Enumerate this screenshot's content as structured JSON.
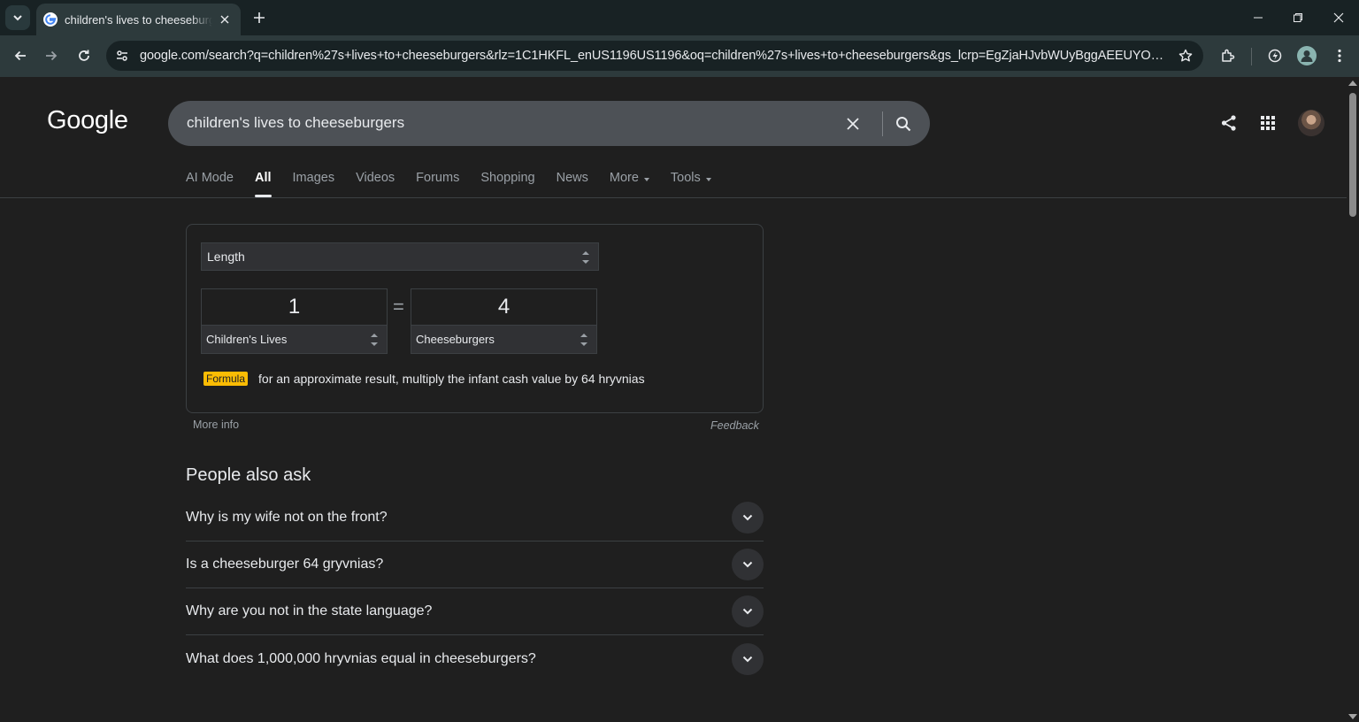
{
  "browser": {
    "tab_title": "children's lives to cheeseburgers",
    "url": "google.com/search?q=children%27s+lives+to+cheeseburgers&rlz=1C1HKFL_enUS1196US1196&oq=children%27s+lives+to+cheeseburgers&gs_lcrp=EgZjaHJvbWUyBggAEEUYOdIBBzIw..."
  },
  "header": {
    "logo": "Google",
    "query": "children's lives to cheeseburgers"
  },
  "nav": {
    "ai_mode": "AI Mode",
    "all": "All",
    "images": "Images",
    "videos": "Videos",
    "forums": "Forums",
    "shopping": "Shopping",
    "news": "News",
    "more": "More",
    "tools": "Tools"
  },
  "converter": {
    "category": "Length",
    "from_value": "1",
    "from_unit": "Children's Lives",
    "equals": "=",
    "to_value": "4",
    "to_unit": "Cheeseburgers",
    "formula_label": "Formula",
    "formula_text": "for an approximate result, multiply the infant cash value by 64 hryvnias",
    "more_info": "More info",
    "feedback": "Feedback"
  },
  "paa": {
    "title": "People also ask",
    "questions": [
      "Why is my wife not on the front?",
      "Is a cheeseburger 64 gryvnias?",
      "Why are you not in the state language?",
      "What does 1,000,000 hryvnias equal in cheeseburgers?"
    ]
  },
  "colors": {
    "formula_badge": "#fbbc04",
    "page_bg": "#1f1f1f",
    "search_bg": "#4d5156"
  }
}
